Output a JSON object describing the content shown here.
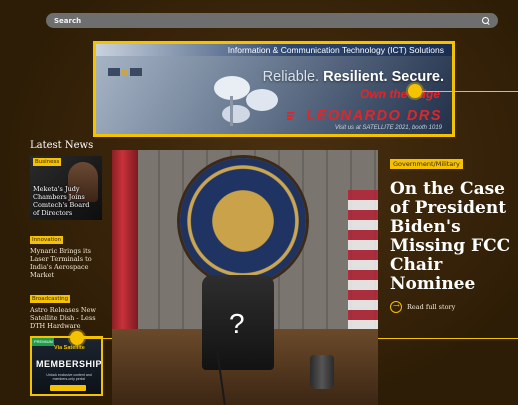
{
  "search": {
    "label": "Search"
  },
  "banner": {
    "topline": "Information & Communication Technology (ICT) Solutions",
    "headline_muted": "Reliable.",
    "headline_strong": "Resilient. Secure.",
    "sub": "Own the Edge",
    "brand": "LEONARDO DRS",
    "caption": "Visit us at SATELLITE 2021, booth 1019"
  },
  "sidebar": {
    "title": "Latest News",
    "items": [
      {
        "tag": "Business",
        "headline": "Meketa's Judy Chambers Joins Comtech's Board of Directors"
      },
      {
        "tag": "Innovation",
        "headline": "Mynaric Brings its Laser Terminals to India's Aerospace Market"
      },
      {
        "tag": "Broadcasting",
        "headline": "Astro Releases New Satellite Dish - Less DTH Hardware"
      }
    ],
    "membership_ad": {
      "flag": "PREMIUM",
      "brand": "Via Satellite",
      "word": "MEMBERSHIP",
      "sub": "Unlock exclusive content and members-only perks!"
    }
  },
  "hero": {
    "overlay": "?"
  },
  "story": {
    "tag": "Government/Military",
    "title": "On the Case of President Biden's Missing FCC Chair Nominee",
    "read_more": "Read full story"
  },
  "colors": {
    "accent": "#f5c200",
    "background": "#3a2508",
    "brand_red": "#e0262a"
  },
  "icons": [
    "search-icon",
    "arrow-right-icon",
    "logo-mark-icon"
  ]
}
